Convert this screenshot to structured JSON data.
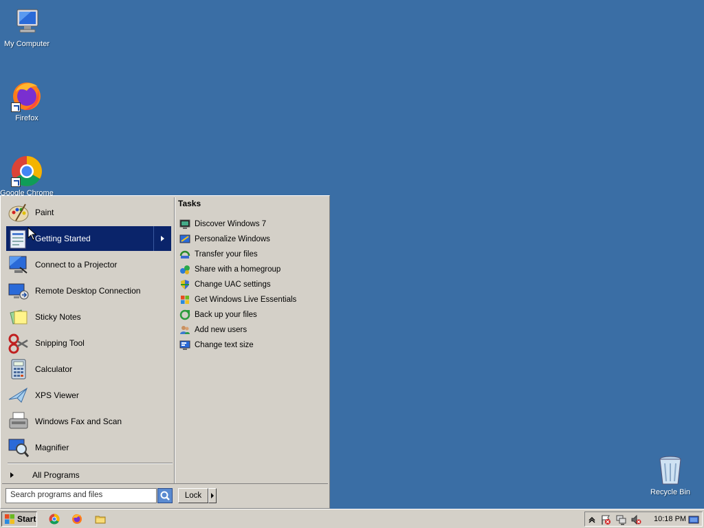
{
  "desktop": {
    "icons": [
      {
        "label": "My Computer",
        "icon": "computer-icon"
      },
      {
        "label": "Firefox",
        "icon": "firefox-icon"
      },
      {
        "label": "Google Chrome",
        "icon": "chrome-icon"
      },
      {
        "label": "Recycle Bin",
        "icon": "recycle-bin-icon"
      }
    ],
    "background_color": "#3a6ea5"
  },
  "start_menu": {
    "programs": [
      {
        "label": "Paint",
        "icon": "paint-icon"
      },
      {
        "label": "Getting Started",
        "icon": "getting-started-icon",
        "selected": true,
        "has_submenu": true
      },
      {
        "label": "Connect to a Projector",
        "icon": "projector-icon"
      },
      {
        "label": "Remote Desktop Connection",
        "icon": "remote-desktop-icon"
      },
      {
        "label": "Sticky Notes",
        "icon": "sticky-notes-icon"
      },
      {
        "label": "Snipping Tool",
        "icon": "snipping-tool-icon"
      },
      {
        "label": "Calculator",
        "icon": "calculator-icon"
      },
      {
        "label": "XPS Viewer",
        "icon": "xps-viewer-icon"
      },
      {
        "label": "Windows Fax and Scan",
        "icon": "fax-scan-icon"
      },
      {
        "label": "Magnifier",
        "icon": "magnifier-icon"
      }
    ],
    "all_programs_label": "All Programs",
    "tasks_title": "Tasks",
    "tasks": [
      {
        "label": "Discover Windows 7",
        "icon": "discover-icon"
      },
      {
        "label": "Personalize Windows",
        "icon": "personalize-icon"
      },
      {
        "label": "Transfer your files",
        "icon": "transfer-icon"
      },
      {
        "label": "Share with a homegroup",
        "icon": "homegroup-icon"
      },
      {
        "label": "Change UAC settings",
        "icon": "uac-shield-icon"
      },
      {
        "label": "Get Windows Live Essentials",
        "icon": "windows-live-icon"
      },
      {
        "label": "Back up your files",
        "icon": "backup-icon"
      },
      {
        "label": "Add new users",
        "icon": "users-icon"
      },
      {
        "label": "Change text size",
        "icon": "text-size-icon"
      }
    ],
    "search_placeholder": "Search programs and files",
    "lock_label": "Lock",
    "selected_color": "#0a246a"
  },
  "taskbar": {
    "start_label": "Start",
    "quick_launch": [
      "chrome-icon",
      "firefox-icon",
      "file-explorer-icon"
    ],
    "tray_icons": [
      "show-hidden-icons-arrow",
      "action-center-icon",
      "network-icon",
      "volume-muted-icon"
    ],
    "clock": "10:18 PM"
  }
}
